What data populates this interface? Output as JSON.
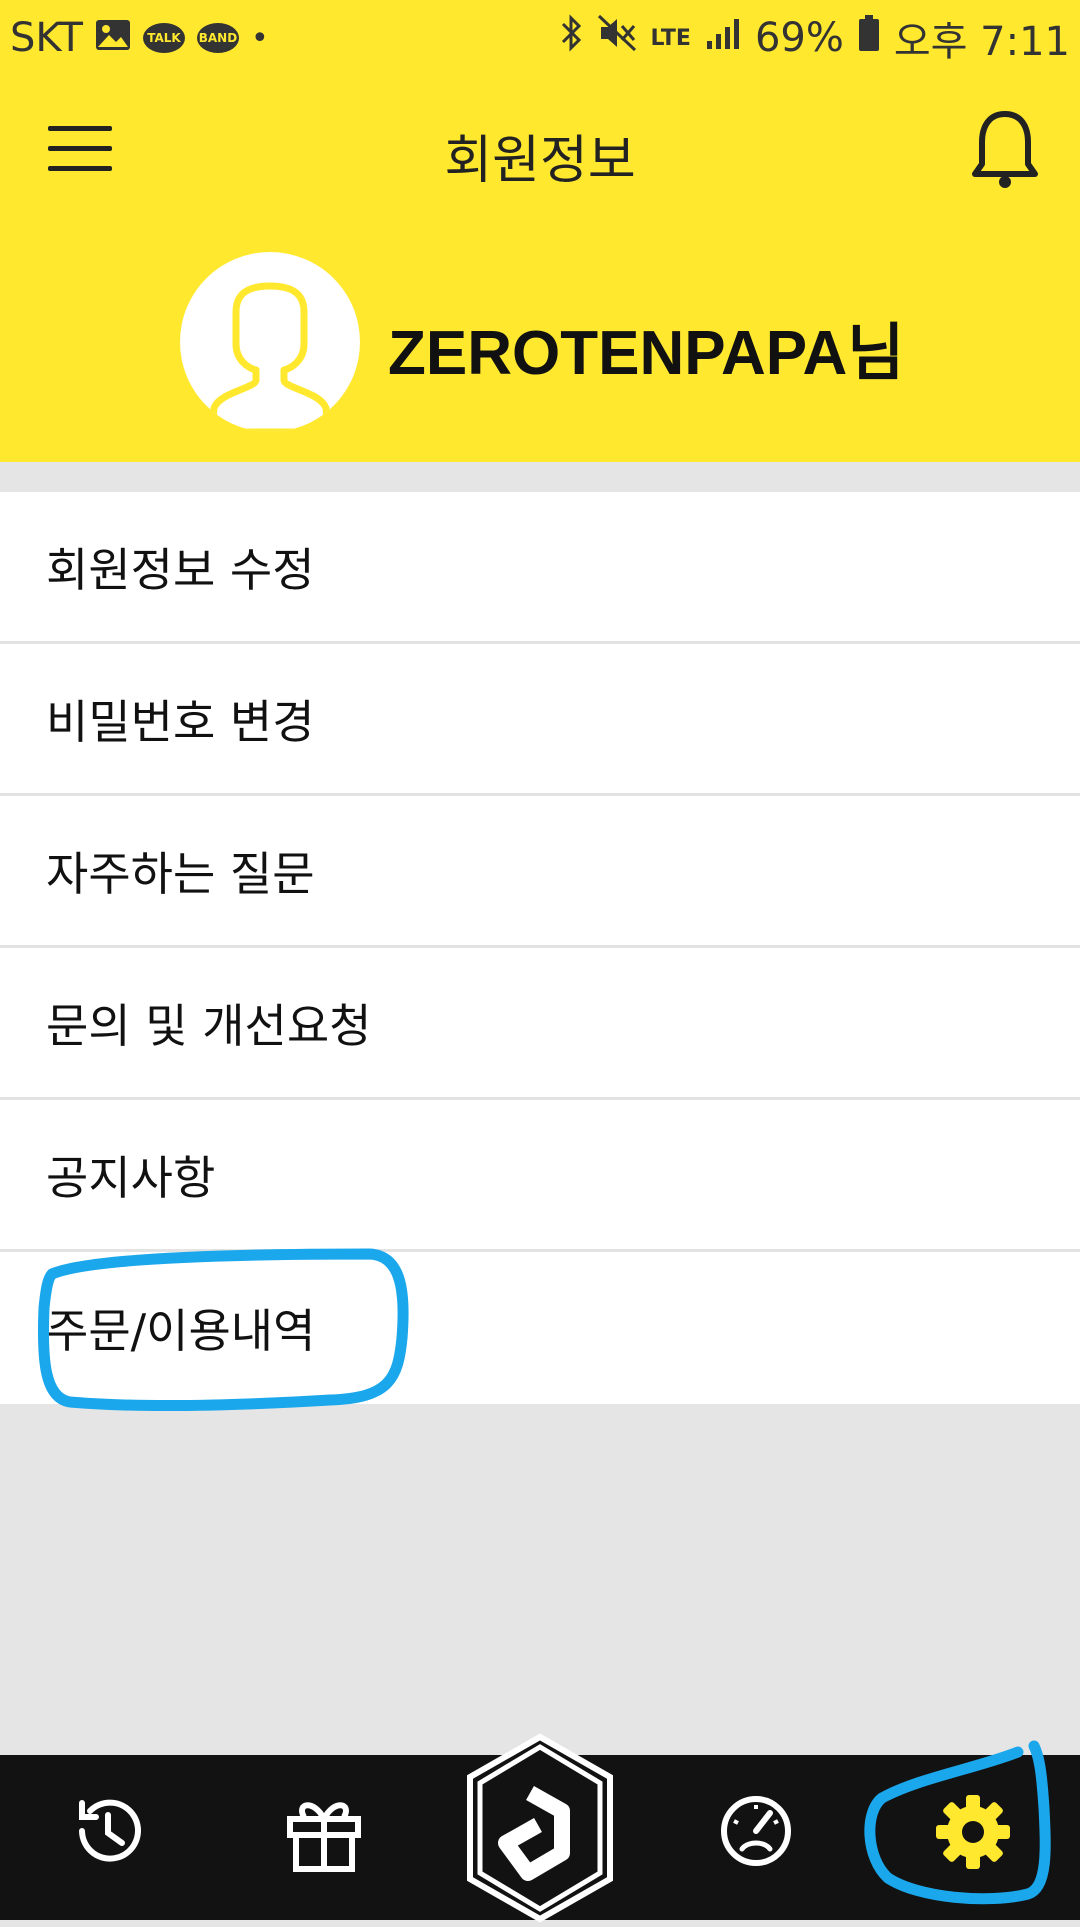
{
  "status_bar": {
    "carrier": "SKT",
    "badge_talk": "TALK",
    "badge_band": "BAND",
    "network": "LTE",
    "battery": "69%",
    "time": "오후 7:11"
  },
  "header": {
    "title": "회원정보",
    "username": "ZEROTENPAPA님"
  },
  "menu": {
    "items": [
      {
        "label": "회원정보 수정"
      },
      {
        "label": "비밀번호 변경"
      },
      {
        "label": "자주하는 질문"
      },
      {
        "label": "문의 및 개선요청"
      },
      {
        "label": "공지사항"
      },
      {
        "label": "주문/이용내역"
      }
    ]
  },
  "bottom_nav": {
    "items": [
      "history-icon",
      "gift-icon",
      "app-logo-icon",
      "speedometer-icon",
      "settings-icon"
    ],
    "active": "settings-icon"
  },
  "colors": {
    "brand_yellow": "#ffe82e",
    "nav_bg": "#121212",
    "annotation_blue": "#1aa7ec"
  }
}
